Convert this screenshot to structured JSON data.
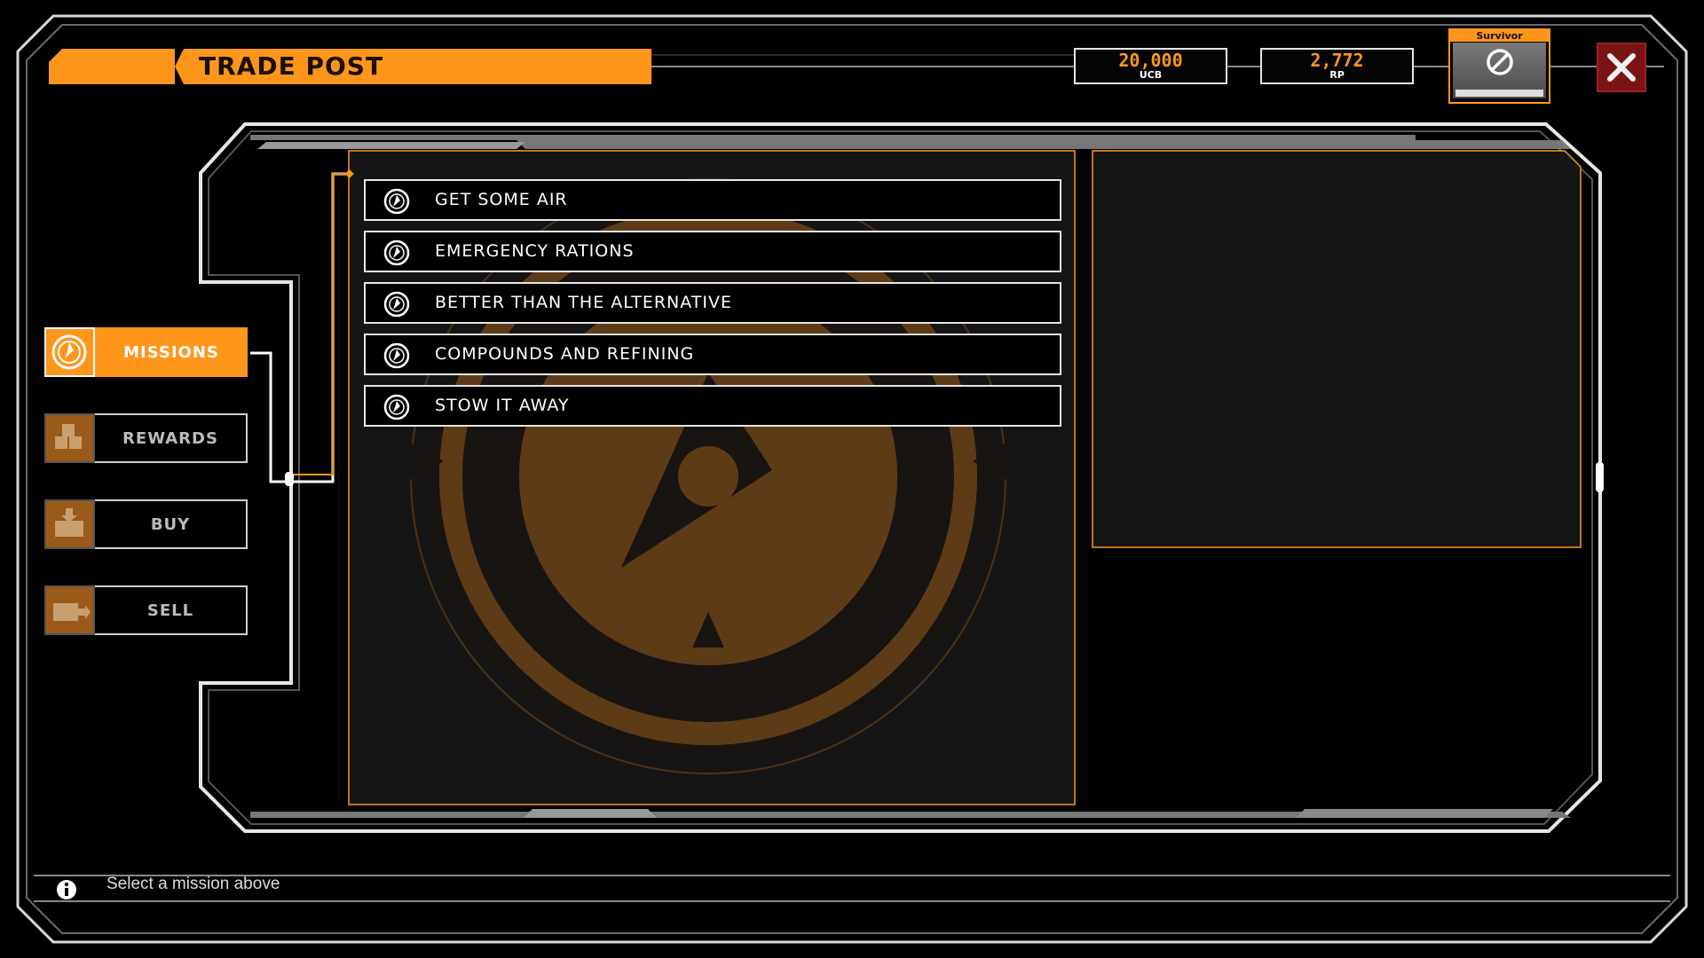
{
  "header": {
    "title": "TRADE POST"
  },
  "currencies": [
    {
      "amount": "20,000",
      "unit": "UCB"
    },
    {
      "amount": "2,772",
      "unit": "RP"
    }
  ],
  "rank": {
    "label": "Survivor",
    "icon": "no-symbol-icon",
    "progress_percent": 100
  },
  "nav": {
    "tabs": [
      {
        "label": "MISSIONS",
        "icon": "compass-icon",
        "active": true
      },
      {
        "label": "REWARDS",
        "icon": "boxes-icon",
        "active": false
      },
      {
        "label": "BUY",
        "icon": "box-in-icon",
        "active": false
      },
      {
        "label": "SELL",
        "icon": "truck-out-icon",
        "active": false
      }
    ]
  },
  "missions": [
    {
      "label": "GET SOME AIR",
      "icon": "compass-icon"
    },
    {
      "label": "EMERGENCY RATIONS",
      "icon": "compass-icon"
    },
    {
      "label": "BETTER THAN THE ALTERNATIVE",
      "icon": "compass-icon"
    },
    {
      "label": "COMPOUNDS AND REFINING",
      "icon": "compass-icon"
    },
    {
      "label": "STOW IT AWAY",
      "icon": "compass-icon"
    }
  ],
  "status": {
    "message": "Select a mission above",
    "icon": "info-icon"
  },
  "colors": {
    "accent": "#ff961c",
    "frame": "#e6e6e6",
    "close": "#7a1414"
  }
}
